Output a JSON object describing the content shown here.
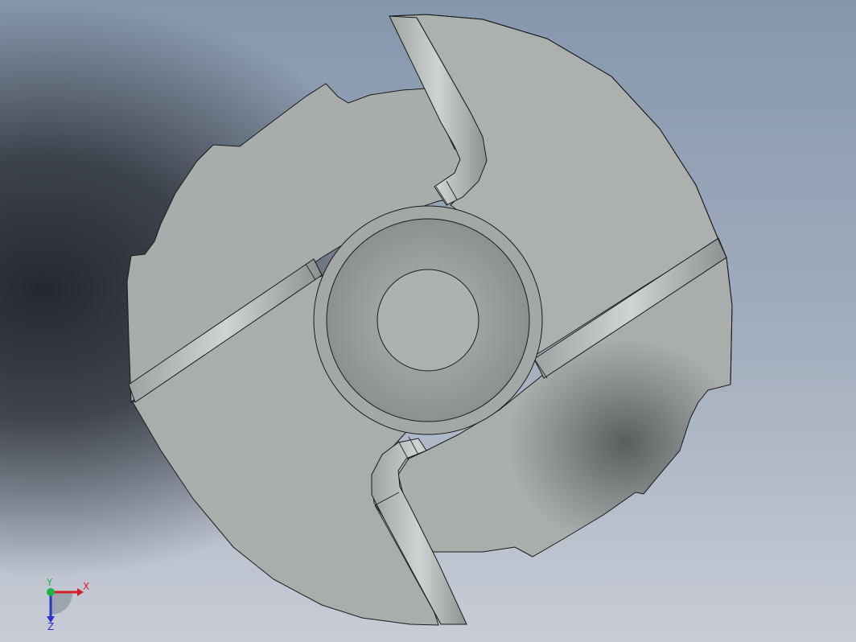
{
  "viewport": {
    "background_colors": [
      "#8a9bb0",
      "#2b2f36",
      "#c7ccd6"
    ],
    "part_color": "#a9aeac"
  },
  "triad": {
    "x_label": "X",
    "y_label": "Y",
    "z_label": "Z",
    "x_color": "#d0202a",
    "y_color": "#1fb34a",
    "z_color": "#2830c8"
  }
}
